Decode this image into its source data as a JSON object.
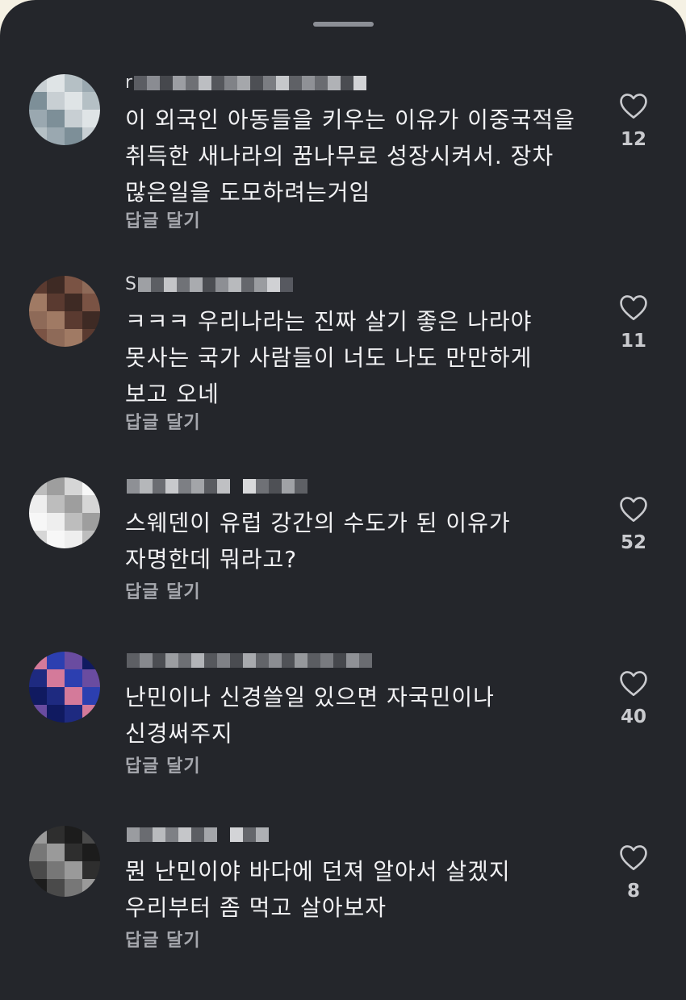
{
  "comments": [
    {
      "username_visible": "r",
      "text": "이 외국인 아동들을 키우는 이유가 이중국적을\n취득한 새나라의 꿈나무로 성장시켜서. 장차\n많은일을 도모하려는거임",
      "reply_label": "답글 달기",
      "likes": "12",
      "colors": {
        "avatar": [
          "#c8cfd3",
          "#9aa8b0",
          "#dfe4e6",
          "#7d8f98",
          "#b5c0c5"
        ]
      }
    },
    {
      "username_visible": "S",
      "text": "ㅋㅋㅋ 우리나라는 진짜 살기 좋은 나라야\n못사는 국가 사람들이 너도 나도 만만하게\n보고 오네",
      "reply_label": "답글 달기",
      "likes": "11",
      "colors": {
        "avatar": [
          "#7a5344",
          "#5a3a30",
          "#8e6a58",
          "#3e2a24",
          "#a07a64"
        ]
      }
    },
    {
      "username_visible": "",
      "text": "스웨덴이 유럽 강간의 수도가 된 이유가\n자명한데 뭐라고?",
      "reply_label": "답글 달기",
      "likes": "52",
      "colors": {
        "avatar": [
          "#eeeeee",
          "#d6d6d6",
          "#bdbdbd",
          "#f7f7f7",
          "#9e9e9e"
        ]
      }
    },
    {
      "username_visible": "",
      "text": "난민이나 신경쓸일 있으면 자국민이나\n신경써주지",
      "reply_label": "답글 달기",
      "likes": "40",
      "colors": {
        "avatar": [
          "#2c3fb0",
          "#1e2a80",
          "#6a4ca0",
          "#d47a9a",
          "#101a60"
        ]
      }
    },
    {
      "username_visible": "",
      "text": "뭔 난민이야 바다에 던져 알아서 살겠지\n우리부터 좀 먹고 살아보자",
      "reply_label": "답글 달기",
      "likes": "8",
      "colors": {
        "avatar": [
          "#4a4a4a",
          "#2e2e2e",
          "#777777",
          "#1c1c1c",
          "#9a9a9a"
        ]
      }
    }
  ],
  "icons": {
    "like": "heart-outline-icon",
    "grabber": "drag-handle"
  },
  "theme": {
    "sheet": "#24262b",
    "text": "#f2f2f4",
    "muted": "#a6a8ae"
  }
}
